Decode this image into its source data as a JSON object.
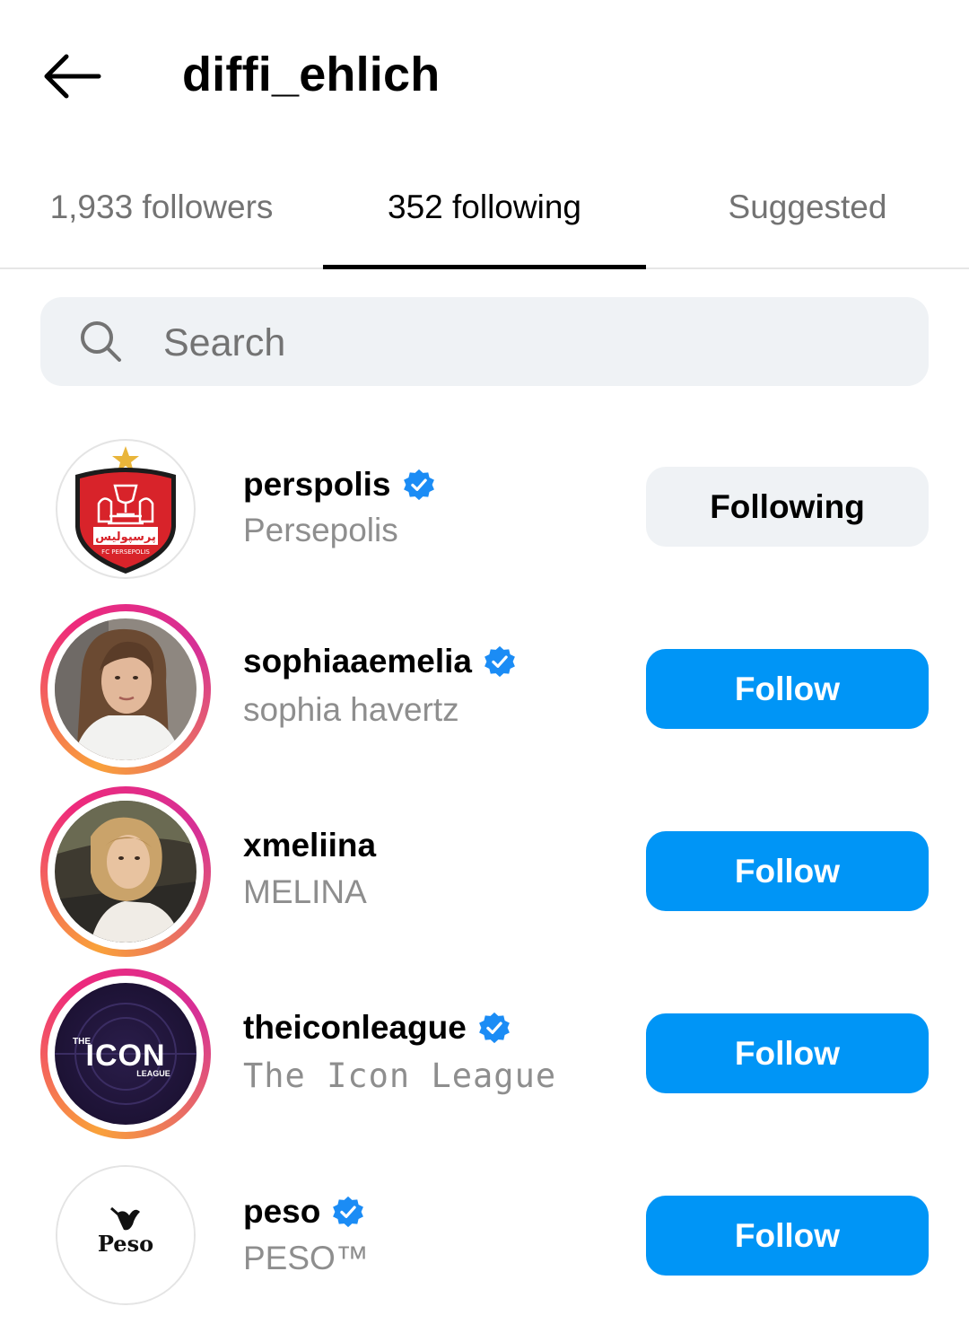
{
  "header": {
    "back_icon": "arrow-left-icon",
    "title": "diffi_ehlich"
  },
  "tabs": [
    {
      "label": "1,933 followers",
      "active": false
    },
    {
      "label": "352 following",
      "active": true
    },
    {
      "label": "Suggested",
      "active": false
    }
  ],
  "search": {
    "icon": "search-icon",
    "placeholder": "Search",
    "value": ""
  },
  "colors": {
    "follow_button": "#0095f6",
    "following_button": "#eff2f5",
    "verified_badge": "#1b8cf5",
    "secondary_text": "#8e8e8e"
  },
  "accounts": [
    {
      "username": "perspolis",
      "full_name": "Persepolis",
      "verified": true,
      "story_ring": false,
      "button": "Following",
      "avatar": "persepolis-crest"
    },
    {
      "username": "sophiaaemelia",
      "full_name": "sophia havertz",
      "verified": true,
      "story_ring": true,
      "button": "Follow",
      "avatar": "profile-photo"
    },
    {
      "username": "xmeliina",
      "full_name": "MELINA",
      "verified": false,
      "story_ring": true,
      "button": "Follow",
      "avatar": "profile-photo"
    },
    {
      "username": "theiconleague",
      "full_name": "The Icon League",
      "verified": true,
      "story_ring": true,
      "button": "Follow",
      "avatar": "icon-league-logo"
    },
    {
      "username": "peso",
      "full_name": "PESO™",
      "verified": true,
      "story_ring": false,
      "button": "Follow",
      "avatar": "peso-logo"
    }
  ],
  "logos": {
    "persepolis_text": "پرسپولیس",
    "persepolis_sub": "FC PERSEPOLIS",
    "icon_league_small": "THE",
    "icon_league_big": "ICON",
    "icon_league_sub": "LEAGUE",
    "peso_word": "Peso"
  }
}
